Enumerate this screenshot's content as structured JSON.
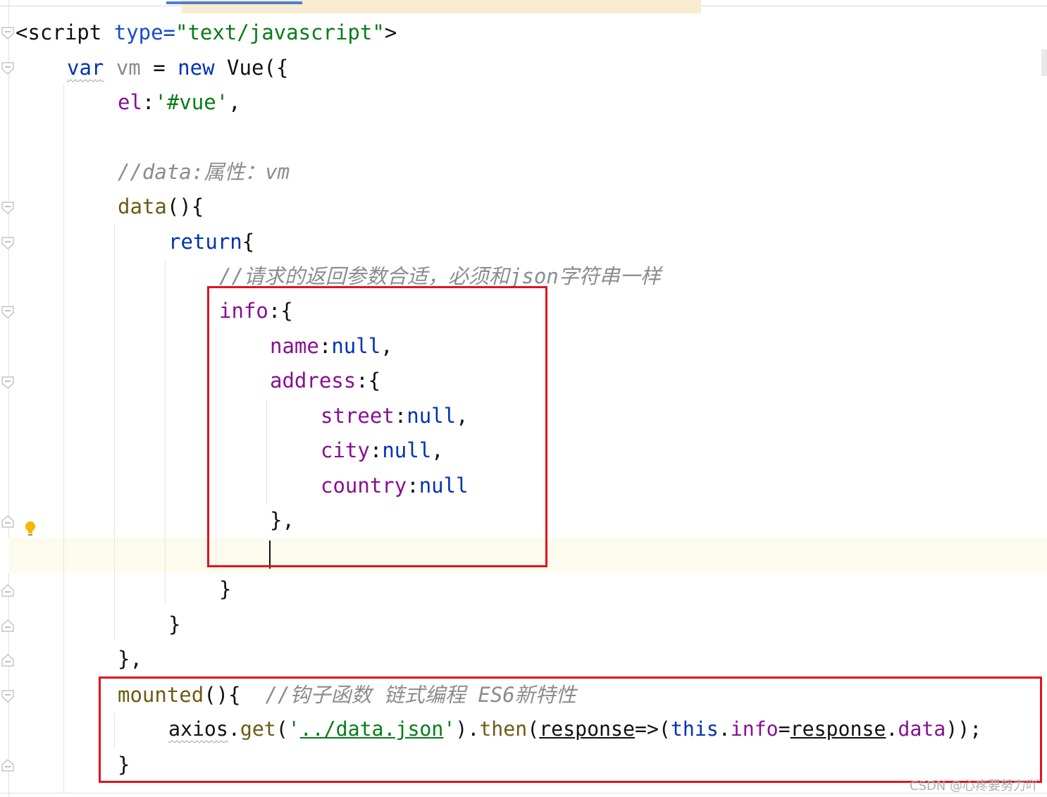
{
  "editor": {
    "lines": [
      {
        "id": "script-tag",
        "parts": [
          "<script ",
          "type=",
          "\"text/javascript\"",
          ">"
        ]
      },
      {
        "id": "vm-decl",
        "parts": [
          "var",
          " vm",
          " = ",
          "new",
          " Vue({"
        ]
      },
      {
        "id": "el-prop",
        "parts": [
          "el",
          ":",
          "'#vue'",
          ","
        ]
      },
      {
        "id": "data-comment",
        "parts": [
          "//data:属性：vm"
        ]
      },
      {
        "id": "data-fn",
        "parts": [
          "data",
          "(){"
        ]
      },
      {
        "id": "return-line",
        "parts": [
          "return",
          "{"
        ]
      },
      {
        "id": "json-comment",
        "parts": [
          "//请求的返回参数合适，必须和json字符串一样"
        ]
      },
      {
        "id": "info-line",
        "parts": [
          "info",
          ":{"
        ]
      },
      {
        "id": "name-line",
        "parts": [
          "name",
          ":",
          "null",
          ","
        ]
      },
      {
        "id": "address-line",
        "parts": [
          "address",
          ":{"
        ]
      },
      {
        "id": "street-line",
        "parts": [
          "street",
          ":",
          "null",
          ","
        ]
      },
      {
        "id": "city-line",
        "parts": [
          "city",
          ":",
          "null",
          ","
        ]
      },
      {
        "id": "country-line",
        "parts": [
          "country",
          ":",
          "null"
        ]
      },
      {
        "id": "address-close",
        "parts": [
          "},"
        ]
      },
      {
        "id": "info-close",
        "parts": [
          "}"
        ]
      },
      {
        "id": "return-close",
        "parts": [
          "}"
        ]
      },
      {
        "id": "data-close",
        "parts": [
          "},"
        ]
      },
      {
        "id": "mounted-line",
        "parts": [
          "mounted",
          "(){",
          "  //钩子函数 链式编程 ES6新特性"
        ]
      },
      {
        "id": "axios-line",
        "parts": [
          "axios",
          ".",
          "get",
          "(",
          "'",
          "../data.json",
          "'",
          ").",
          "then",
          "(",
          "response",
          "=>(",
          "this",
          ".",
          "info",
          "=",
          "response",
          ".",
          "data",
          "));"
        ]
      },
      {
        "id": "mounted-close",
        "parts": [
          "}"
        ]
      }
    ]
  },
  "colors": {
    "keyword": "#0033b3",
    "attribute": "#174ad4",
    "string": "#067d17",
    "property": "#871094",
    "function": "#00627a",
    "comment": "#8c8c8c",
    "highlight_box": "#e0131f",
    "current_line": "#fdfbee"
  },
  "icons": [
    "fold-icon",
    "lightbulb-icon"
  ],
  "watermark": "CSDN @心疼要努力吖"
}
